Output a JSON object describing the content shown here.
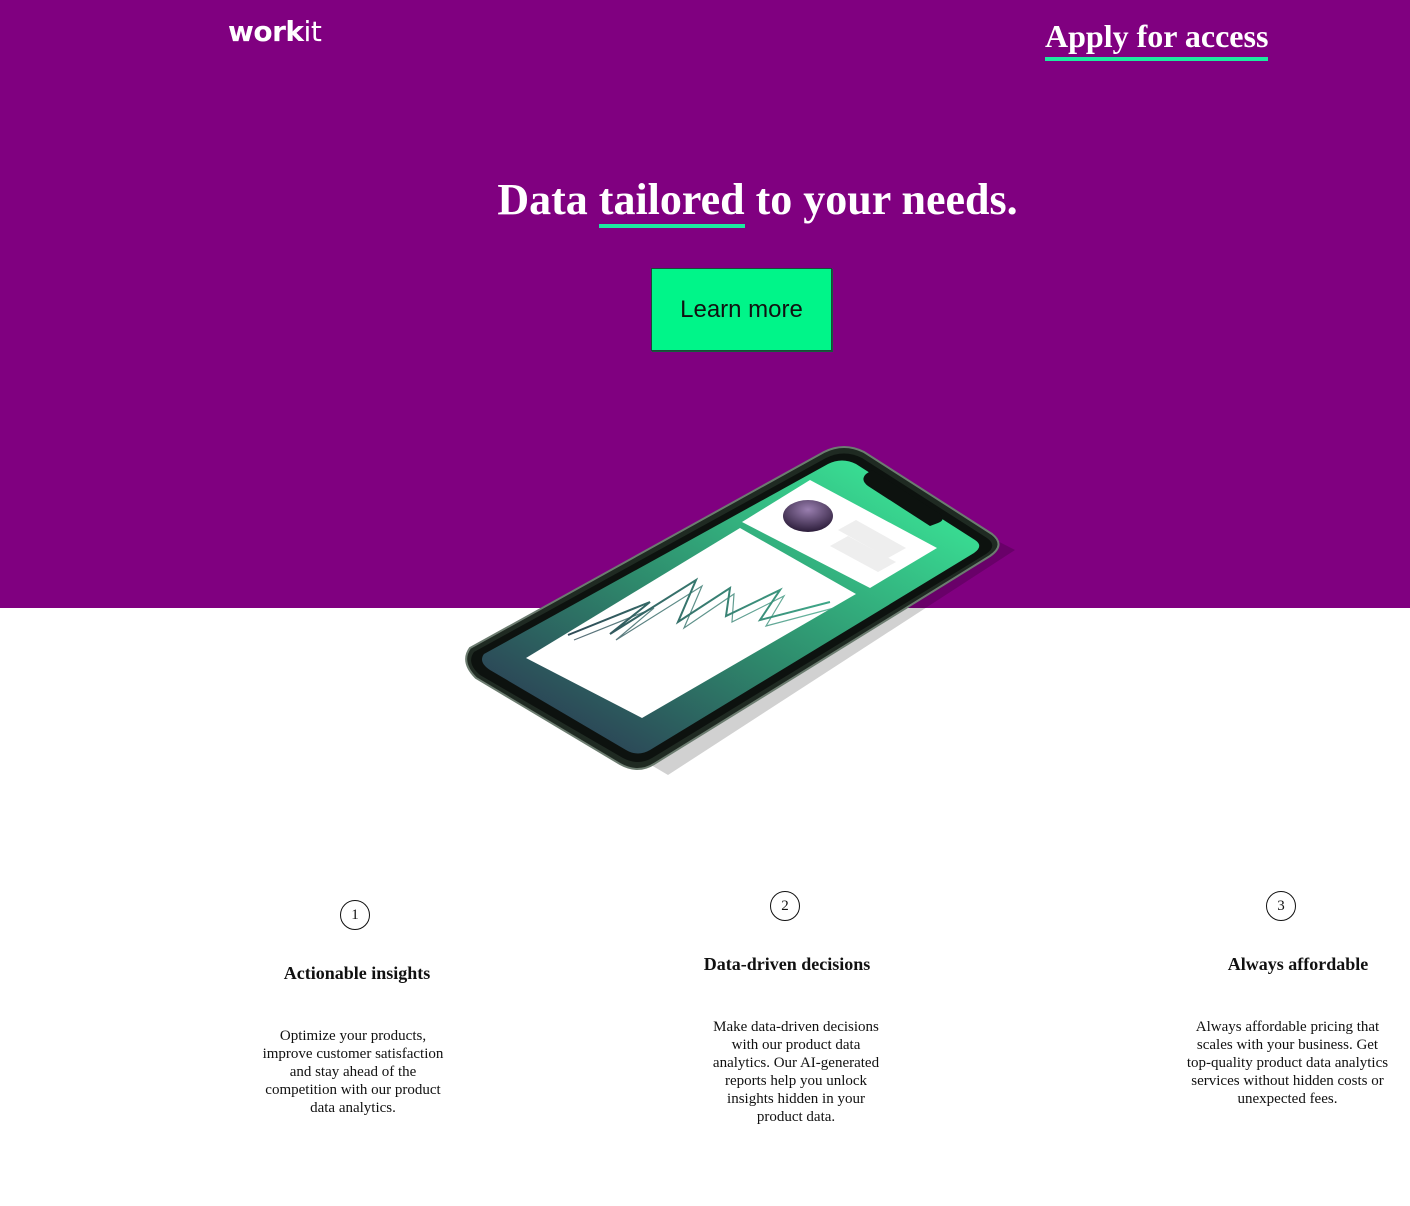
{
  "header": {
    "logo_bold": "work",
    "logo_light": "it",
    "apply_link": "Apply for access"
  },
  "hero": {
    "headline_before": "Data ",
    "headline_accent": "tailored",
    "headline_after": " to your needs.",
    "cta_label": "Learn more"
  },
  "colors": {
    "brand_purple": "#800080",
    "accent_green": "#00f589",
    "underline_green": "#1de9a0"
  },
  "features": [
    {
      "number": "1",
      "title": "Actionable insights",
      "description": "Optimize your products, improve customer satisfaction and stay ahead of the competition with our product data analytics."
    },
    {
      "number": "2",
      "title": "Data-driven decisions",
      "description": "Make data-driven decisions with our product data analytics. Our AI-generated reports help you unlock insights hidden in your product data."
    },
    {
      "number": "3",
      "title": "Always affordable",
      "description": "Always affordable pricing that scales with your business. Get top-quality product data analytics services without hidden costs or unexpected fees."
    }
  ]
}
